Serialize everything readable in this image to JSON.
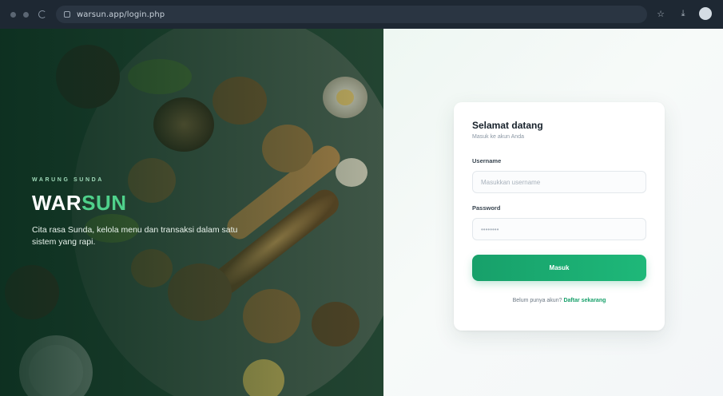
{
  "browser": {
    "url": "warsun.app/login.php",
    "icons": [
      "back-icon",
      "forward-icon",
      "reload-icon",
      "star-icon",
      "download-icon",
      "profile-icon"
    ]
  },
  "hero": {
    "eyebrow": "WARUNG SUNDA",
    "brand_part1": "WAR",
    "brand_part2": "SUN",
    "tagline": "Cita rasa Sunda, kelola menu dan transaksi dalam satu sistem yang rapi.",
    "accent_color": "#4fd18b"
  },
  "login": {
    "title": "Selamat datang",
    "subtitle": "Masuk ke akun Anda",
    "username_label": "Username",
    "username_placeholder": "Masukkan username",
    "password_label": "Password",
    "password_placeholder": "••••••••",
    "submit_label": "Masuk",
    "footer_text": "Belum punya akun?",
    "footer_link": "Daftar sekarang",
    "button_color": "#17a06a"
  }
}
